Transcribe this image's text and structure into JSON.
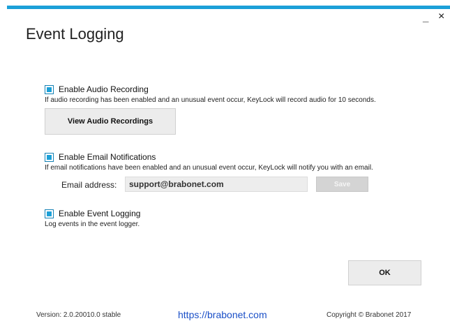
{
  "window": {
    "title": "Event Logging",
    "minimize_label": "_",
    "close_label": "×",
    "accent_color": "#1ba0d8"
  },
  "audio": {
    "checkbox_label": "Enable Audio Recording",
    "checked": true,
    "description": "If audio recording has been enabled and an unusual event occur, KeyLock will record audio for 10 seconds.",
    "button_label": "View Audio Recordings"
  },
  "email": {
    "checkbox_label": "Enable Email Notifications",
    "checked": true,
    "description": "If email notifications have been enabled and an unusual event occur, KeyLock will notify you with an email.",
    "address_label": "Email address:",
    "address_value": "support@brabonet.com",
    "save_label": "Save"
  },
  "logging": {
    "checkbox_label": "Enable Event Logging",
    "checked": true,
    "description": "Log events in the event logger."
  },
  "ok_label": "OK",
  "footer": {
    "version": "Version: 2.0.20010.0 stable",
    "link": "https://brabonet.com",
    "copyright": "Copyright © Brabonet 2017"
  }
}
